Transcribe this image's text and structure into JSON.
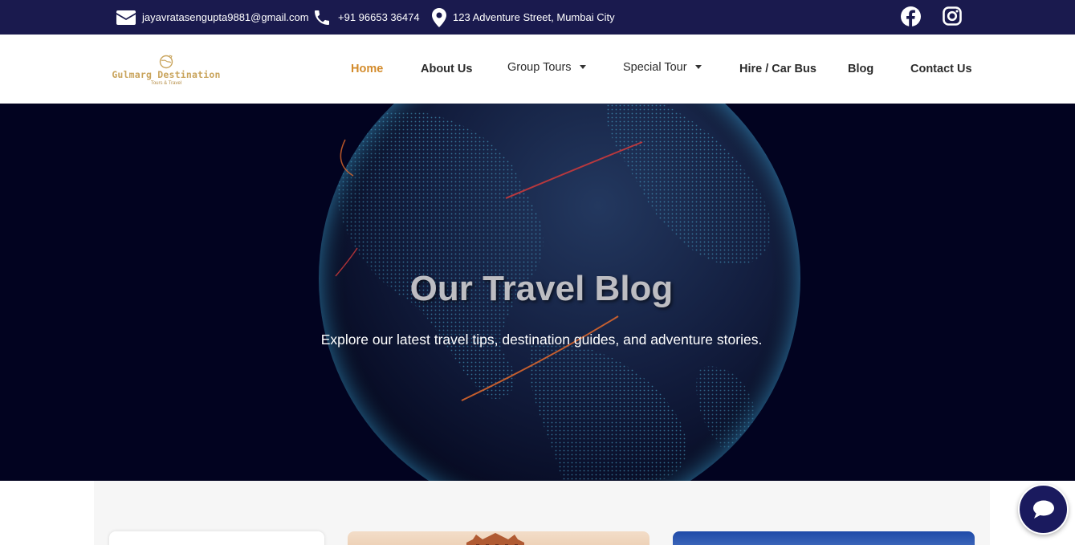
{
  "topbar": {
    "email": "jayavratasengupta9881@gmail.com",
    "phone": "+91 96653 36474",
    "address": "123 Adventure Street, Mumbai City"
  },
  "logo": {
    "title": "Gulmarg Destination",
    "subtitle": "Tours & Travel"
  },
  "nav": {
    "items": [
      {
        "label": "Home"
      },
      {
        "label": "About Us"
      },
      {
        "label": "Group Tours"
      },
      {
        "label": "Special Tour"
      },
      {
        "label": "Hire / Car Bus"
      },
      {
        "label": "Blog"
      },
      {
        "label": "Contact Us"
      }
    ]
  },
  "hero": {
    "title": "Our Travel Blog",
    "subtitle": "Explore our latest travel tips, destination guides, and adventure stories."
  },
  "colors": {
    "topbar_bg": "#1a1a4e",
    "accent": "#d38b2b",
    "hero_bg": "#020320",
    "chat_bg": "#1a1a5e"
  },
  "icons": [
    "envelope-icon",
    "phone-icon",
    "map-pin-icon",
    "facebook-icon",
    "instagram-icon",
    "chat-icon",
    "chevron-down-icon"
  ]
}
